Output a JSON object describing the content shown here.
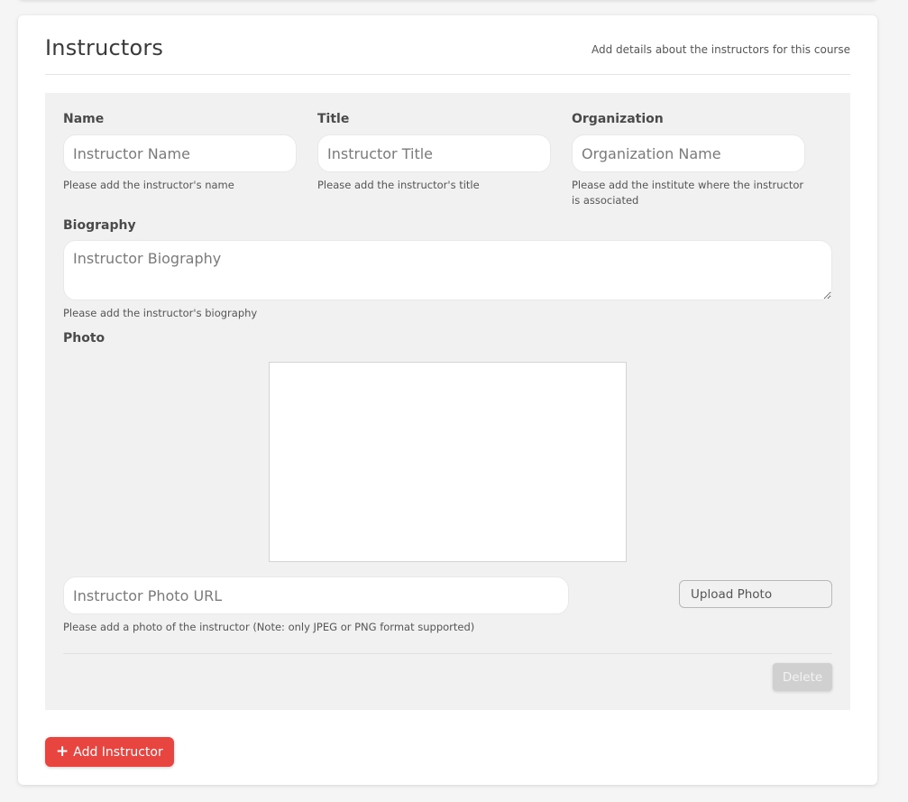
{
  "section": {
    "title": "Instructors",
    "subtitle": "Add details about the instructors for this course"
  },
  "instructor": {
    "name": {
      "label": "Name",
      "placeholder": "Instructor Name",
      "help": "Please add the instructor's name"
    },
    "title": {
      "label": "Title",
      "placeholder": "Instructor Title",
      "help": "Please add the instructor's title"
    },
    "organization": {
      "label": "Organization",
      "placeholder": "Organization Name",
      "help_line1": "Please add the institute where the instructor",
      "help_line2": "is associated"
    },
    "biography": {
      "label": "Biography",
      "placeholder": "Instructor Biography",
      "help": "Please add the instructor's biography"
    },
    "photo": {
      "label": "Photo",
      "url_placeholder": "Instructor Photo URL",
      "upload_label": "Upload Photo",
      "help": "Please add a photo of the instructor (Note: only JPEG or PNG format supported)"
    },
    "delete_label": "Delete"
  },
  "add_instructor": {
    "icon": "plus-icon",
    "label": "Add Instructor"
  },
  "colors": {
    "accent": "#e84540",
    "panel": "#f1f1f1"
  }
}
